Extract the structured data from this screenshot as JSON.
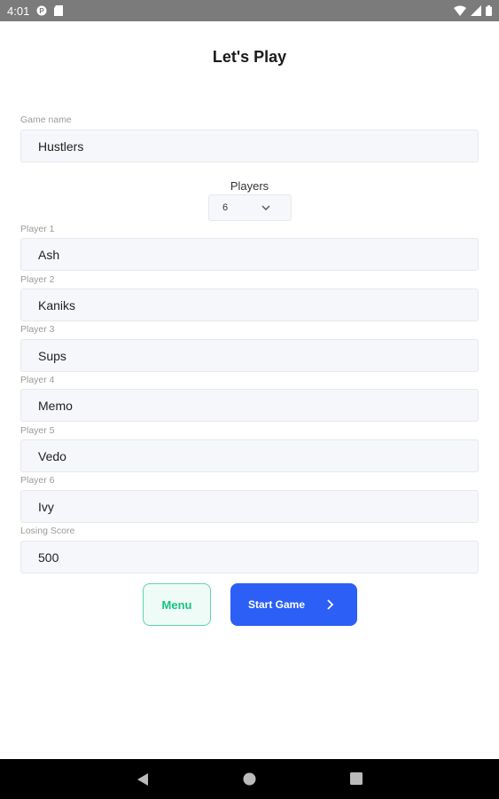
{
  "status_bar": {
    "time": "4:01",
    "icons": [
      "notification-icon",
      "sd-card-icon",
      "wifi-icon",
      "signal-icon",
      "battery-icon"
    ]
  },
  "title": "Let's Play",
  "game_name": {
    "label": "Game name",
    "value": "Hustlers"
  },
  "players": {
    "label": "Players",
    "selected": "6"
  },
  "player_fields": [
    {
      "label": "Player 1",
      "value": "Ash"
    },
    {
      "label": "Player 2",
      "value": "Kaniks"
    },
    {
      "label": "Player 3",
      "value": "Sups"
    },
    {
      "label": "Player 4",
      "value": "Memo"
    },
    {
      "label": "Player 5",
      "value": "Vedo"
    },
    {
      "label": "Player 6",
      "value": "Ivy"
    }
  ],
  "losing_score": {
    "label": "Losing Score",
    "value": "500"
  },
  "buttons": {
    "menu": "Menu",
    "start": "Start Game"
  },
  "colors": {
    "primary": "#2c5ff5",
    "menu_accent": "#17c383",
    "status_bar": "#7b7b7b",
    "nav_bar": "#000000"
  }
}
